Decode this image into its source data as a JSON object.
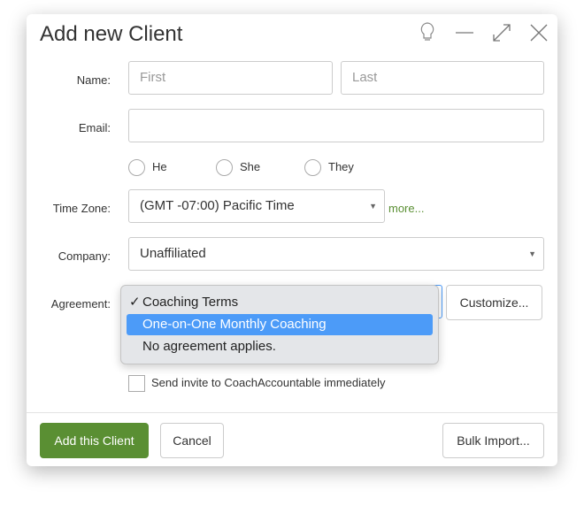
{
  "title": "Add new Client",
  "fields": {
    "name_label": "Name:",
    "first_placeholder": "First",
    "last_placeholder": "Last",
    "email_label": "Email:",
    "pronouns": [
      "He",
      "She",
      "They"
    ],
    "timezone_label": "Time Zone:",
    "timezone_value": "(GMT -07:00) Pacific Time",
    "more_link": "more...",
    "company_label": "Company:",
    "company_value": "Unaffiliated",
    "agreement_label": "Agreement:",
    "agreement_options": [
      {
        "label": "Coaching Terms",
        "checked": true
      },
      {
        "label": "One-on-One Monthly Coaching",
        "highlighted": true
      },
      {
        "label": "No agreement applies."
      }
    ],
    "check_mark": "✓",
    "customize_label": "Customize...",
    "invite_label": "Send invite to CoachAccountable immediately"
  },
  "footer": {
    "add_label": "Add this Client",
    "cancel_label": "Cancel",
    "bulk_label": "Bulk Import..."
  },
  "colors": {
    "primary": "#5a8f33",
    "link": "#5a8f33",
    "highlight": "#4c9bf8"
  }
}
